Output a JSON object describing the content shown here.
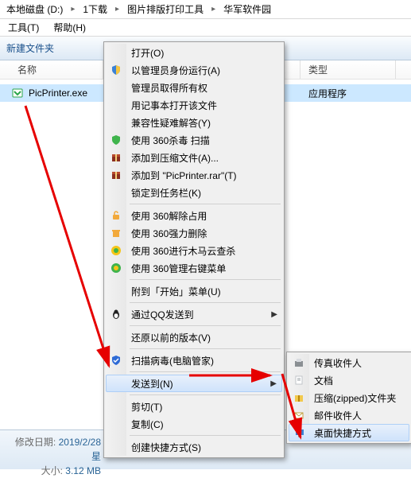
{
  "breadcrumb": [
    "本地磁盘 (D:)",
    "1下载",
    "图片排版打印工具",
    "华军软件园"
  ],
  "menubar": {
    "tools": "工具(T)",
    "help": "帮助(H)"
  },
  "toolbar": {
    "new_folder": "新建文件夹"
  },
  "columns": {
    "name": "名称",
    "type": "类型"
  },
  "file": {
    "name": "PicPrinter.exe",
    "type": "应用程序"
  },
  "status": {
    "mod_label": "修改日期:",
    "mod_value": "2019/2/28 星",
    "size_label": "大小:",
    "size_value": "3.12 MB"
  },
  "context_menu": [
    {
      "label": "打开(O)"
    },
    {
      "label": "以管理员身份运行(A)",
      "icon": "shield"
    },
    {
      "label": "管理员取得所有权"
    },
    {
      "label": "用记事本打开该文件"
    },
    {
      "label": "兼容性疑难解答(Y)"
    },
    {
      "label": "使用 360杀毒 扫描",
      "icon": "av-green"
    },
    {
      "label": "添加到压缩文件(A)...",
      "icon": "archive"
    },
    {
      "label": "添加到 \"PicPrinter.rar\"(T)",
      "icon": "archive"
    },
    {
      "label": "锁定到任务栏(K)"
    },
    {
      "sep": true
    },
    {
      "label": "使用 360解除占用",
      "icon": "unlock"
    },
    {
      "label": "使用 360强力删除",
      "icon": "delete"
    },
    {
      "label": "使用 360进行木马云查杀",
      "icon": "ball-y"
    },
    {
      "label": "使用 360管理右键菜单",
      "icon": "ball-g"
    },
    {
      "sep": true
    },
    {
      "label": "附到「开始」菜单(U)"
    },
    {
      "sep": true
    },
    {
      "label": "通过QQ发送到",
      "icon": "qq",
      "arrow": true
    },
    {
      "sep": true
    },
    {
      "label": "还原以前的版本(V)"
    },
    {
      "sep": true
    },
    {
      "label": "扫描病毒(电脑管家)",
      "icon": "shield-blue"
    },
    {
      "sep": true
    },
    {
      "label": "发送到(N)",
      "arrow": true,
      "hover": true
    },
    {
      "sep": true
    },
    {
      "label": "剪切(T)"
    },
    {
      "label": "复制(C)"
    },
    {
      "sep": true
    },
    {
      "label": "创建快捷方式(S)"
    }
  ],
  "submenu": [
    {
      "label": "传真收件人",
      "icon": "fax"
    },
    {
      "label": "文档",
      "icon": "doc"
    },
    {
      "label": "压缩(zipped)文件夹",
      "icon": "zip"
    },
    {
      "label": "邮件收件人",
      "icon": "mail"
    },
    {
      "label": "桌面快捷方式",
      "icon": "desktop",
      "hover": true
    }
  ]
}
